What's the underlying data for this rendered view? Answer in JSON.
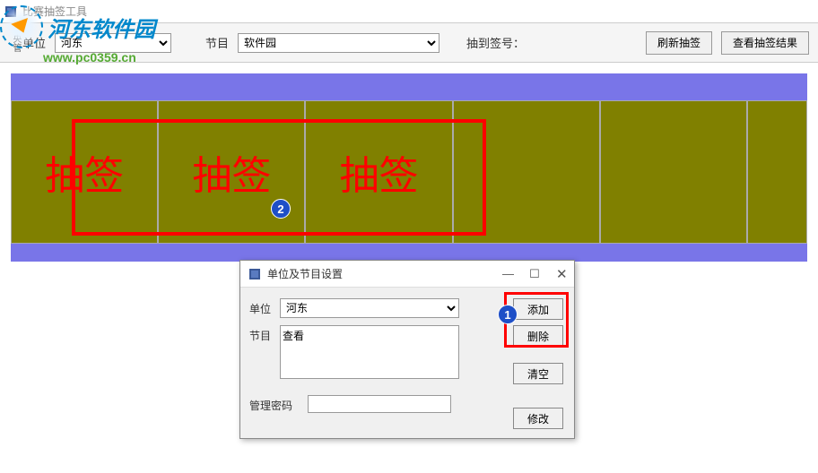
{
  "window": {
    "title": "比赛抽签工具"
  },
  "watermark": {
    "text": "河东软件园",
    "url": "www.pc0359.cn"
  },
  "toolbar": {
    "edge_label": "央管",
    "unit_label": "单位",
    "unit_value": "河东",
    "program_label": "节目",
    "program_value": "软件园",
    "drawn_label": "抽到签号：",
    "refresh_label": "刷新抽签",
    "view_result_label": "查看抽签结果"
  },
  "lottery": {
    "cells": [
      "抽签",
      "抽签",
      "抽签",
      "",
      "",
      ""
    ]
  },
  "markers": {
    "m1": "1",
    "m2": "2"
  },
  "dialog": {
    "title": "单位及节目设置",
    "unit_label": "单位",
    "unit_value": "河东",
    "program_label": "节目",
    "program_value": "查看",
    "add_label": "添加",
    "delete_label": "删除",
    "clear_label": "清空",
    "password_label": "管理密码",
    "modify_label": "修改"
  }
}
